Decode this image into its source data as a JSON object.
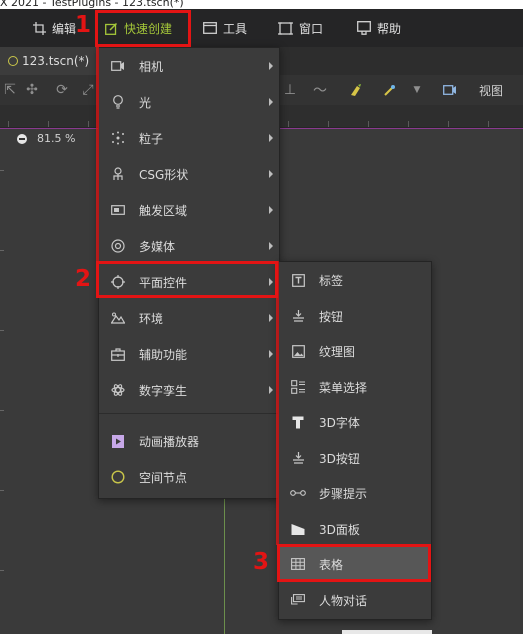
{
  "window": {
    "title": "X 2021 - TestPlugins - 123.tscn(*)"
  },
  "menubar": {
    "items": [
      {
        "label": "编辑",
        "icon": "crop-icon"
      },
      {
        "label": "快速创建",
        "icon": "edit-square-icon"
      },
      {
        "label": "工具",
        "icon": "window-icon"
      },
      {
        "label": "窗口",
        "icon": "frame-icon"
      },
      {
        "label": "帮助",
        "icon": "help-doc-icon"
      }
    ]
  },
  "tab": {
    "label": "123.tscn(*)"
  },
  "toolbar": {
    "view_label": "视图"
  },
  "viewport": {
    "zoom": "81.5 %"
  },
  "quick_create_menu": {
    "items": [
      {
        "label": "相机",
        "icon": "camera-icon",
        "submenu": true
      },
      {
        "label": "光",
        "icon": "bulb-icon",
        "submenu": true
      },
      {
        "label": "粒子",
        "icon": "particles-icon",
        "submenu": true
      },
      {
        "label": "CSG形状",
        "icon": "csg-icon",
        "submenu": true
      },
      {
        "label": "触发区域",
        "icon": "trigger-icon",
        "submenu": true
      },
      {
        "label": "多媒体",
        "icon": "media-icon",
        "submenu": true
      },
      {
        "label": "平面控件",
        "icon": "plane-control-icon",
        "submenu": true
      },
      {
        "label": "环境",
        "icon": "environment-icon",
        "submenu": true
      },
      {
        "label": "辅助功能",
        "icon": "toolbox-icon",
        "submenu": true
      },
      {
        "label": "数字孪生",
        "icon": "atom-icon",
        "submenu": true
      },
      {
        "label": "动画播放器",
        "icon": "animation-player-icon",
        "submenu": false
      },
      {
        "label": "空间节点",
        "icon": "spatial-node-icon",
        "submenu": false
      }
    ]
  },
  "plane_control_submenu": {
    "items": [
      {
        "label": "标签",
        "icon": "label-icon"
      },
      {
        "label": "按钮",
        "icon": "button-icon"
      },
      {
        "label": "纹理图",
        "icon": "texture-icon"
      },
      {
        "label": "菜单选择",
        "icon": "menu-select-icon"
      },
      {
        "label": "3D字体",
        "icon": "text-3d-icon"
      },
      {
        "label": "3D按钮",
        "icon": "button-3d-icon"
      },
      {
        "label": "步骤提示",
        "icon": "steps-icon"
      },
      {
        "label": "3D面板",
        "icon": "panel-3d-icon"
      },
      {
        "label": "表格",
        "icon": "table-icon"
      },
      {
        "label": "人物对话",
        "icon": "dialog-icon"
      }
    ]
  },
  "annotations": {
    "step1": "1",
    "step2": "2",
    "step3": "3"
  },
  "colors": {
    "annotation_red": "#e31414",
    "highlight_row": "#575757",
    "accent_green": "#a4c639",
    "gold_ring": "#c9c64a"
  }
}
